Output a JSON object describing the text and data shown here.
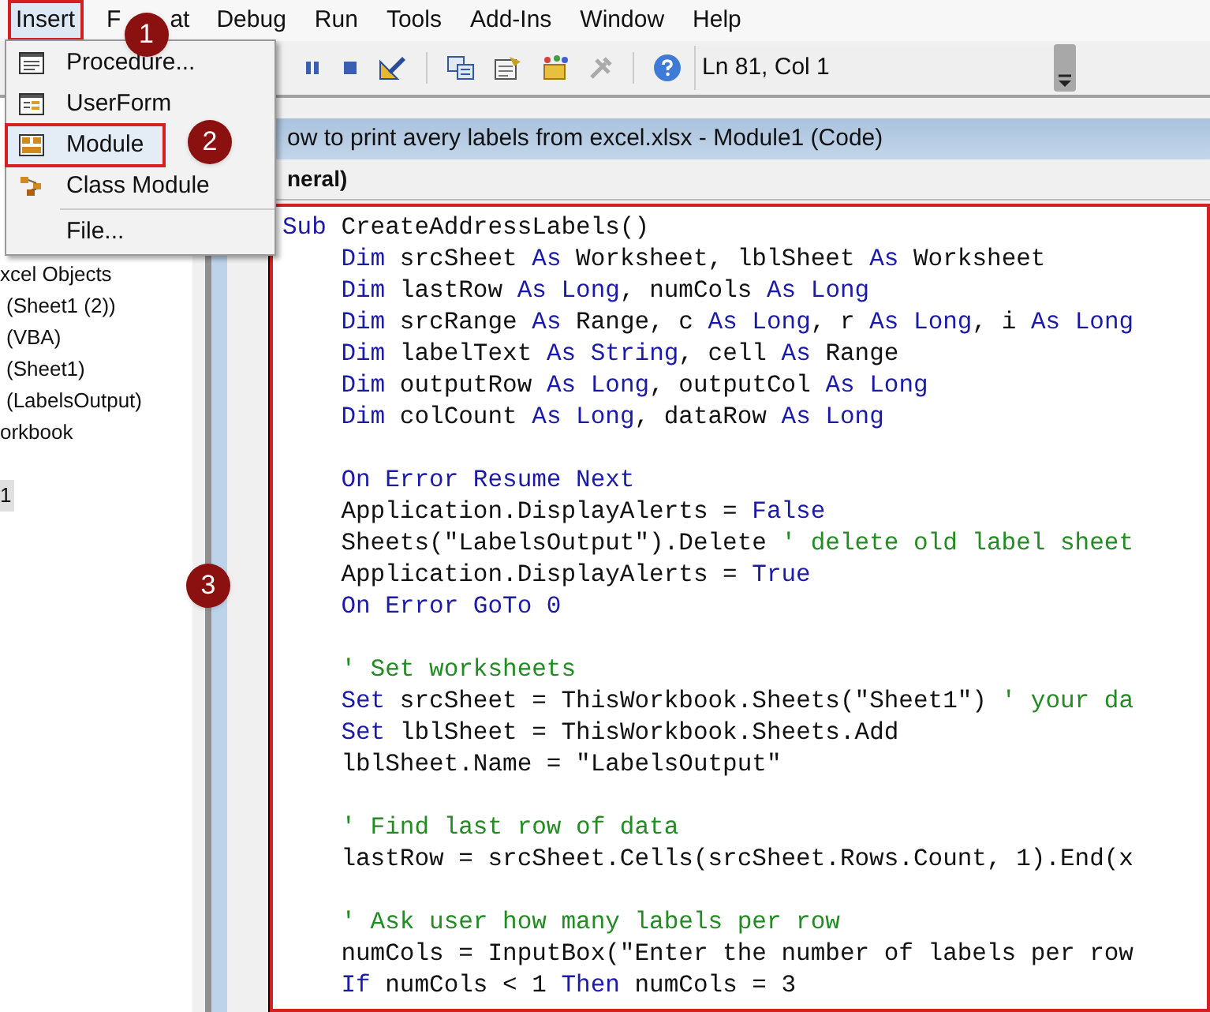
{
  "menu_bar": [
    {
      "label": "Insert",
      "selected": true
    },
    {
      "label": "F",
      "label_after_badge": "at",
      "badge": "1",
      "selected": false
    },
    {
      "label": "Debug",
      "selected": false
    },
    {
      "label": "Run",
      "selected": false
    },
    {
      "label": "Tools",
      "selected": false
    },
    {
      "label": "Add-Ins",
      "selected": false
    },
    {
      "label": "Window",
      "selected": false
    },
    {
      "label": "Help",
      "selected": false
    }
  ],
  "insert_menu": [
    {
      "label": "Procedure...",
      "selected": false
    },
    {
      "label": "UserForm",
      "selected": false
    },
    {
      "label": "Module",
      "selected": true
    },
    {
      "label": "Class Module",
      "selected": false
    },
    {
      "label": "File...",
      "selected": false
    }
  ],
  "toolbar": {
    "position": "Ln 81, Col 1"
  },
  "project_tree": {
    "objects": [
      {
        "label": "xcel Objects",
        "selected": false
      },
      {
        "label": "(Sheet1 (2))",
        "selected": false
      },
      {
        "label": "(VBA)",
        "selected": false
      },
      {
        "label": "(Sheet1)",
        "selected": false
      },
      {
        "label": "(LabelsOutput)",
        "selected": false
      },
      {
        "label": "orkbook",
        "selected": false
      }
    ],
    "modules": [
      {
        "label": "1",
        "selected": true
      }
    ]
  },
  "code_window": {
    "title": "ow to print avery labels from excel.xlsx - Module1 (Code)",
    "object_box": "neral)",
    "blocks": [
      [
        [
          {
            "kind": "keyword",
            "text": "Sub"
          },
          {
            "kind": "plain",
            "text": " CreateAddressLabels()"
          }
        ],
        [
          {
            "kind": "keyword",
            "text": "    Dim"
          },
          {
            "kind": "plain",
            "text": " srcSheet "
          },
          {
            "kind": "keyword",
            "text": "As"
          },
          {
            "kind": "plain",
            "text": " Worksheet, lblSheet "
          },
          {
            "kind": "keyword",
            "text": "As"
          },
          {
            "kind": "plain",
            "text": " Worksheet"
          }
        ],
        [
          {
            "kind": "keyword",
            "text": "    Dim"
          },
          {
            "kind": "plain",
            "text": " lastRow "
          },
          {
            "kind": "keyword",
            "text": "As Long"
          },
          {
            "kind": "plain",
            "text": ", numCols "
          },
          {
            "kind": "keyword",
            "text": "As Long"
          }
        ],
        [
          {
            "kind": "keyword",
            "text": "    Dim"
          },
          {
            "kind": "plain",
            "text": " srcRange "
          },
          {
            "kind": "keyword",
            "text": "As"
          },
          {
            "kind": "plain",
            "text": " Range, c "
          },
          {
            "kind": "keyword",
            "text": "As Long"
          },
          {
            "kind": "plain",
            "text": ", r "
          },
          {
            "kind": "keyword",
            "text": "As Long"
          },
          {
            "kind": "plain",
            "text": ", i "
          },
          {
            "kind": "keyword",
            "text": "As Long"
          }
        ],
        [
          {
            "kind": "keyword",
            "text": "    Dim"
          },
          {
            "kind": "plain",
            "text": " labelText "
          },
          {
            "kind": "keyword",
            "text": "As String"
          },
          {
            "kind": "plain",
            "text": ", cell "
          },
          {
            "kind": "keyword",
            "text": "As"
          },
          {
            "kind": "plain",
            "text": " Range"
          }
        ],
        [
          {
            "kind": "keyword",
            "text": "    Dim"
          },
          {
            "kind": "plain",
            "text": " outputRow "
          },
          {
            "kind": "keyword",
            "text": "As Long"
          },
          {
            "kind": "plain",
            "text": ", outputCol "
          },
          {
            "kind": "keyword",
            "text": "As Long"
          }
        ],
        [
          {
            "kind": "keyword",
            "text": "    Dim"
          },
          {
            "kind": "plain",
            "text": " colCount "
          },
          {
            "kind": "keyword",
            "text": "As Long"
          },
          {
            "kind": "plain",
            "text": ", dataRow "
          },
          {
            "kind": "keyword",
            "text": "As Long"
          }
        ]
      ],
      [
        [
          {
            "kind": "keyword",
            "text": "    On Error Resume Next"
          }
        ],
        [
          {
            "kind": "plain",
            "text": "    Application.DisplayAlerts = "
          },
          {
            "kind": "keyword",
            "text": "False"
          }
        ],
        [
          {
            "kind": "plain",
            "text": "    Sheets(\"LabelsOutput\").Delete "
          },
          {
            "kind": "comment",
            "text": "' delete old label sheet"
          }
        ],
        [
          {
            "kind": "plain",
            "text": "    Application.DisplayAlerts = "
          },
          {
            "kind": "keyword",
            "text": "True"
          }
        ],
        [
          {
            "kind": "keyword",
            "text": "    On Error GoTo 0"
          }
        ]
      ],
      [
        [
          {
            "kind": "comment",
            "text": "    ' Set worksheets"
          }
        ],
        [
          {
            "kind": "keyword",
            "text": "    Set"
          },
          {
            "kind": "plain",
            "text": " srcSheet = ThisWorkbook.Sheets(\"Sheet1\") "
          },
          {
            "kind": "comment",
            "text": "' your da"
          }
        ],
        [
          {
            "kind": "keyword",
            "text": "    Set"
          },
          {
            "kind": "plain",
            "text": " lblSheet = ThisWorkbook.Sheets.Add"
          }
        ],
        [
          {
            "kind": "plain",
            "text": "    lblSheet.Name = \"LabelsOutput\""
          }
        ]
      ],
      [
        [
          {
            "kind": "comment",
            "text": "    ' Find last row of data"
          }
        ],
        [
          {
            "kind": "plain",
            "text": "    lastRow = srcSheet.Cells(srcSheet.Rows.Count, 1).End(x"
          }
        ]
      ],
      [
        [
          {
            "kind": "comment",
            "text": "    ' Ask user how many labels per row"
          }
        ],
        [
          {
            "kind": "plain",
            "text": "    numCols = InputBox(\"Enter the number of labels per row"
          }
        ],
        [
          {
            "kind": "keyword",
            "text": "    If"
          },
          {
            "kind": "plain",
            "text": " numCols < 1 "
          },
          {
            "kind": "keyword",
            "text": "Then"
          },
          {
            "kind": "plain",
            "text": " numCols = 3"
          }
        ]
      ]
    ]
  },
  "step_badges": [
    "2",
    "3"
  ]
}
